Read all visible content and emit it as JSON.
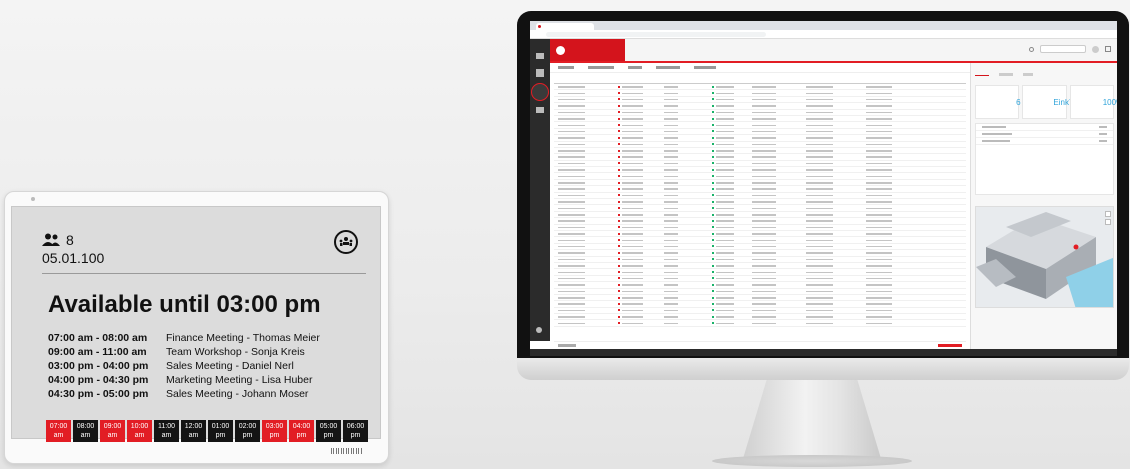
{
  "sign": {
    "capacity": "8",
    "room_id": "05.01.100",
    "availability": "Available until 03:00 pm",
    "meetings": [
      {
        "time": "07:00 am - 08:00 am",
        "title": "Finance Meeting - Thomas Meier"
      },
      {
        "time": "09:00 am - 11:00 am",
        "title": "Team Workshop - Sonja Kreis"
      },
      {
        "time": "03:00 pm - 04:00 pm",
        "title": "Sales Meeting - Daniel Nerl"
      },
      {
        "time": "04:00 pm - 04:30 pm",
        "title": "Marketing Meeting - Lisa Huber"
      },
      {
        "time": "04:30 pm - 05:00 pm",
        "title": "Sales Meeting - Johann Moser"
      }
    ],
    "timeline": [
      {
        "time": "07:00",
        "ampm": "am",
        "busy": true
      },
      {
        "time": "08:00",
        "ampm": "am",
        "busy": false
      },
      {
        "time": "09:00",
        "ampm": "am",
        "busy": true
      },
      {
        "time": "10:00",
        "ampm": "am",
        "busy": true
      },
      {
        "time": "11:00",
        "ampm": "am",
        "busy": false
      },
      {
        "time": "12:00",
        "ampm": "am",
        "busy": false
      },
      {
        "time": "01:00",
        "ampm": "pm",
        "busy": false
      },
      {
        "time": "02:00",
        "ampm": "pm",
        "busy": false
      },
      {
        "time": "03:00",
        "ampm": "pm",
        "busy": true
      },
      {
        "time": "04:00",
        "ampm": "pm",
        "busy": true
      },
      {
        "time": "05:00",
        "ampm": "pm",
        "busy": false
      },
      {
        "time": "06:00",
        "ampm": "pm",
        "busy": false
      }
    ],
    "busy_color": "#e21d24",
    "free_color": "#141414"
  },
  "dashboard": {
    "kpis": [
      {
        "value": "6"
      },
      {
        "value": "Eink75"
      },
      {
        "value": "100%"
      }
    ],
    "accent_color": "#d4141c"
  }
}
